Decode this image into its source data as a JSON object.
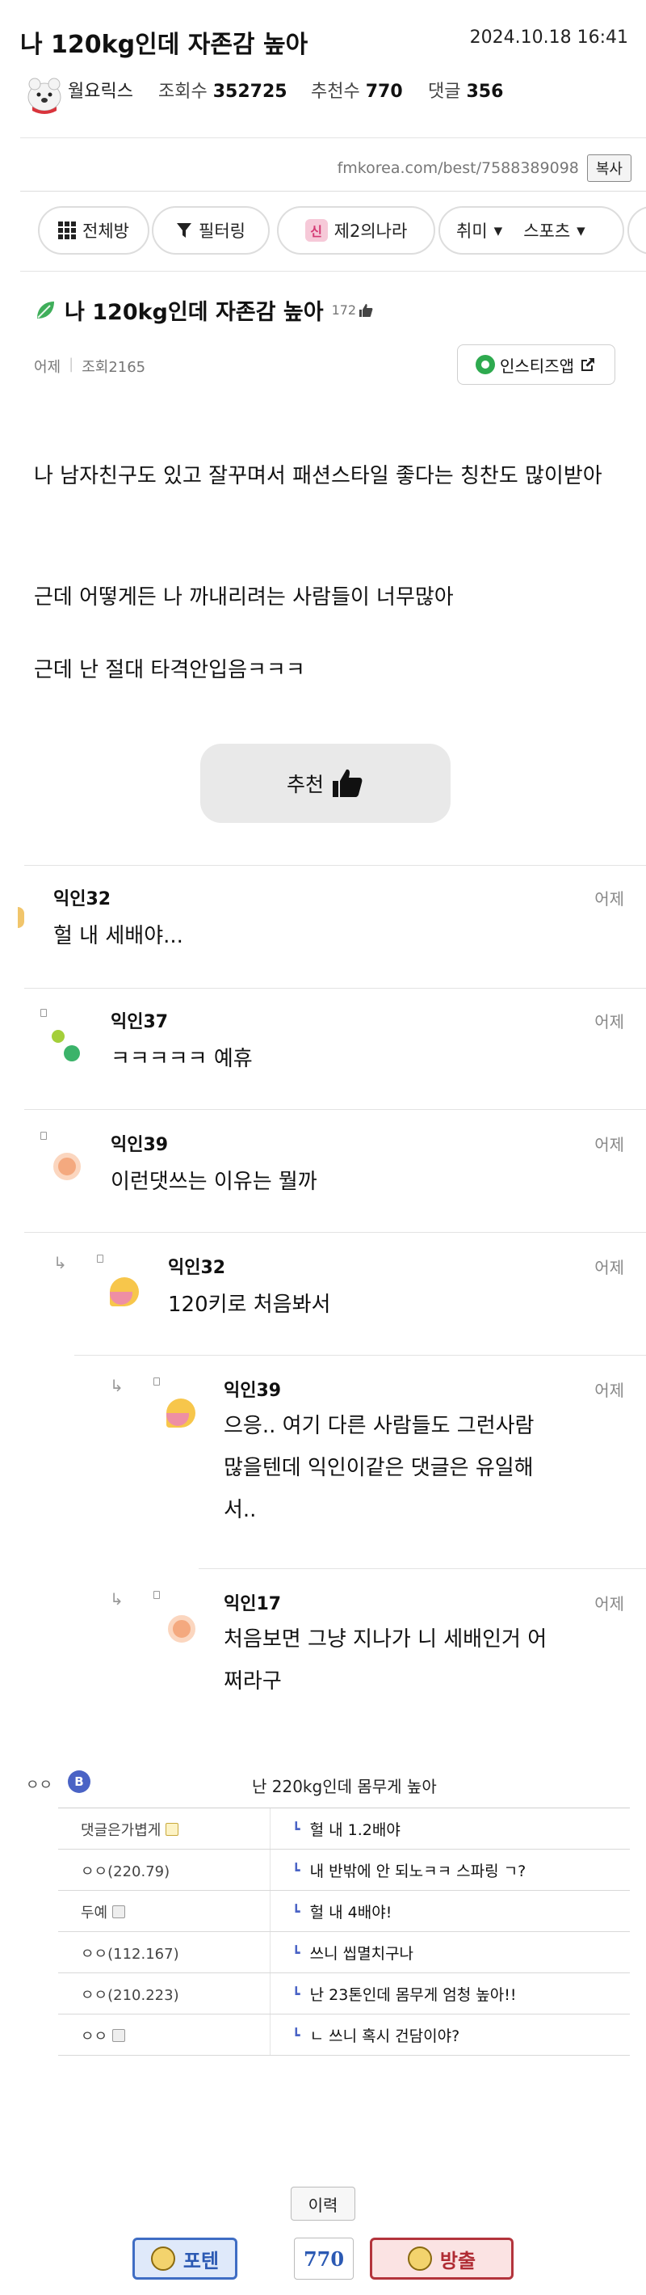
{
  "header": {
    "title": "나 120kg인데 자존감 높아",
    "date": "2024.10.18 16:41",
    "author": "월요릭스",
    "views_label": "조회수",
    "views": "352725",
    "recs_label": "추천수",
    "recs": "770",
    "comments_label": "댓글",
    "comments": "356"
  },
  "url_bar": {
    "url": "fmkorea.com/best/7588389098",
    "copy_label": "복사"
  },
  "nav": {
    "all_label": "전체방",
    "filter_label": "필터링",
    "shin_badge": "신",
    "second_country_label": "제2의나라",
    "hobby_label": "취미",
    "sports_label": "스포츠"
  },
  "article": {
    "title": "나 120kg인데 자존감 높아",
    "likes": "172",
    "time": "어제",
    "views": "조회2165",
    "insti_label": "인스티즈앱",
    "paragraphs": [
      "나 남자친구도 있고 잘꾸며서 패션스타일 좋다는 칭찬도 많이받아",
      "근데 어떻게든 나 까내리려는 사람들이 너무많아",
      "근데 난 절대 타격안입음ㅋㅋㅋ"
    ],
    "recommend_label": "추천"
  },
  "comments": [
    {
      "name": "익인32",
      "date": "어제",
      "text": "헐 내 세배야..."
    },
    {
      "name": "익인37",
      "date": "어제",
      "text": "ㅋㅋㅋㅋㅋ 예휴"
    },
    {
      "name": "익인39",
      "date": "어제",
      "text": "이런댓쓰는 이유는 뭘까"
    },
    {
      "name": "익인32",
      "date": "어제",
      "text": "120키로 처음봐서"
    },
    {
      "name": "익인39",
      "date": "어제",
      "text_line1": "으응.. 여기 다른 사람들도 그런사람",
      "text_line2": "많을텐데 익인이같은 댓글은 유일해",
      "text_line3": "서.."
    },
    {
      "name": "익인17",
      "date": "어제",
      "text_line1": "처음보면 그냥 지나가 니 세배인거 어",
      "text_line2": "쩌라구"
    }
  ],
  "related": {
    "prefix": "ㅇㅇ",
    "badge": "B",
    "title": "난 220kg인데 몸무게 높아",
    "rows": [
      {
        "nick": "댓글은가볍게",
        "text": "헐 내 1.2배야"
      },
      {
        "nick": "ㅇㅇ(220.79)",
        "text": "내 반밖에 안 되노ㅋㅋ 스파링 ㄱ?"
      },
      {
        "nick": "두예",
        "text": "헐 내 4배야!"
      },
      {
        "nick": "ㅇㅇ(112.167)",
        "text": "쓰니 씹멸치구나"
      },
      {
        "nick": "ㅇㅇ(210.223)",
        "text": "난 23톤인데 몸무게 엄청 높아!!"
      },
      {
        "nick": "ㅇㅇ",
        "text": "ㄴ 쓰니 혹시 건담이야?"
      }
    ]
  },
  "footer": {
    "history_label": "이력",
    "up_label": "포텐",
    "count": "770",
    "down_label": "방출"
  },
  "colors": {
    "accent_blue": "#3f6dc4",
    "accent_red": "#b3343c",
    "insti_green": "#2eaa4f"
  }
}
